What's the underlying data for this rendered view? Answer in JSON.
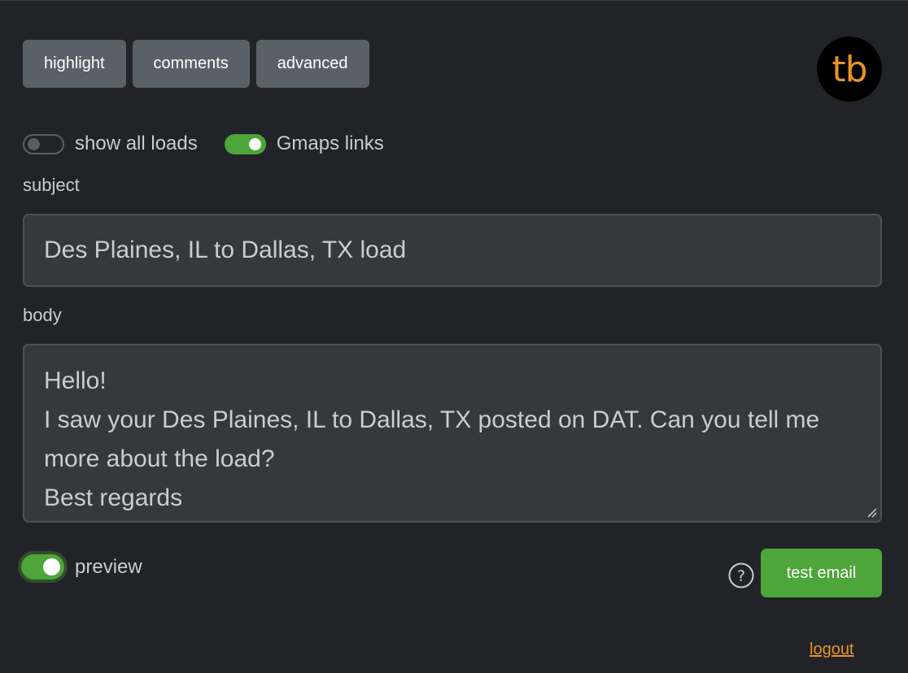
{
  "tabs": [
    {
      "label": "highlight"
    },
    {
      "label": "comments"
    },
    {
      "label": "advanced"
    }
  ],
  "logo": {
    "text": "tb",
    "color": "#e8932b"
  },
  "toggles": {
    "show_all_loads": {
      "label": "show all loads",
      "on": false
    },
    "gmaps_links": {
      "label": "Gmaps links",
      "on": true
    }
  },
  "subject": {
    "label": "subject",
    "value": "Des Plaines, IL to Dallas, TX load"
  },
  "body": {
    "label": "body",
    "value": "Hello!\nI saw your Des Plaines, IL to Dallas, TX posted on DAT. Can you tell me more about the load?\nBest regards"
  },
  "preview": {
    "label": "preview",
    "on": true
  },
  "help": {
    "icon": "question-circle-icon"
  },
  "test_email": {
    "label": "test email"
  },
  "logout": {
    "label": "logout"
  },
  "colors": {
    "background": "#212328",
    "tab": "#5a6067",
    "accent_green": "#4ea53a",
    "link_orange": "#e8932b",
    "input_bg": "#35393e"
  }
}
